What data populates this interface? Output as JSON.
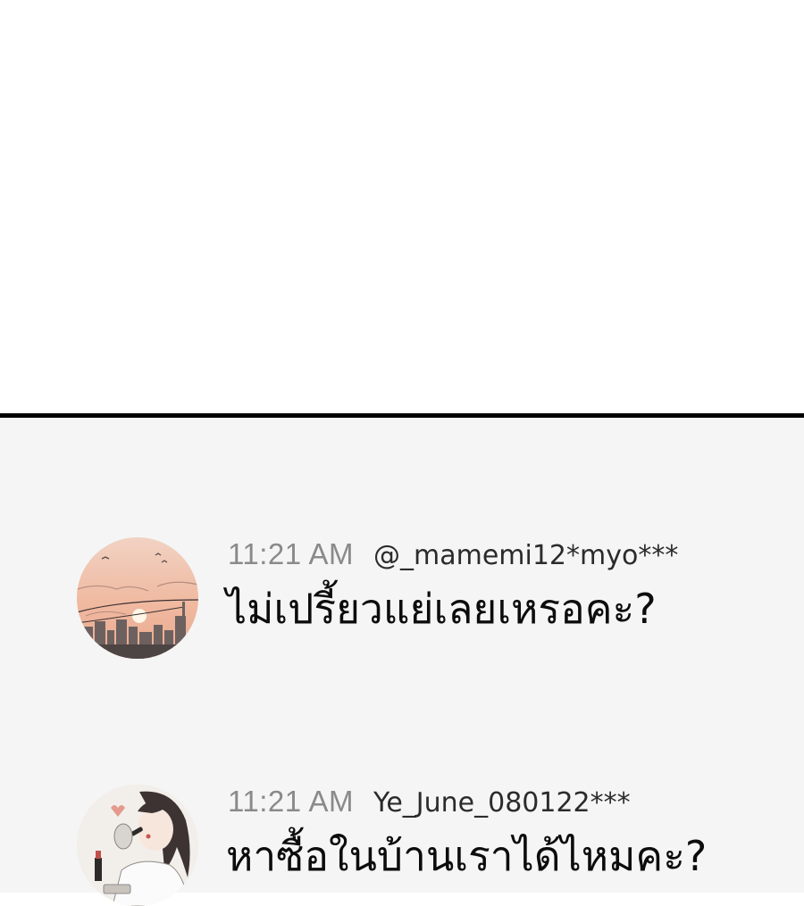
{
  "messages": [
    {
      "time": "11:21 AM",
      "username": "@_mamemi12*myo***",
      "text": "ไม่เปรี้ยวแย่เลยเหรอคะ?",
      "avatar_icon": "sunset-city-avatar"
    },
    {
      "time": "11:21 AM",
      "username": "Ye_June_080122***",
      "text": "หาซื้อในบ้านเราได้ไหมคะ?",
      "avatar_icon": "girl-lipstick-avatar"
    }
  ]
}
